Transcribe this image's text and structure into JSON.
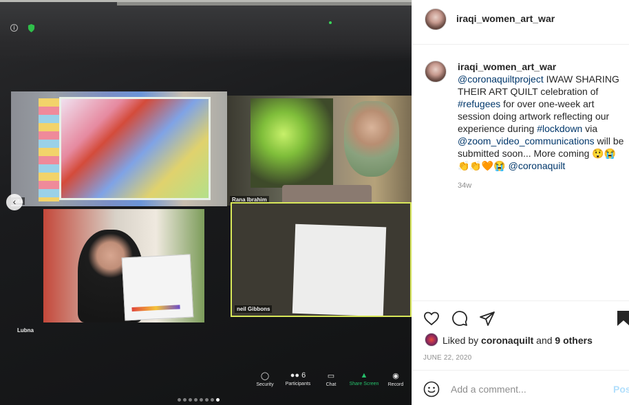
{
  "post": {
    "username": "iraqi_women_art_war",
    "caption": {
      "username": "iraqi_women_art_war",
      "mention_project": "@coronaquiltproject",
      "text1": " IWAW SHARING THEIR ART QUILT celebration of ",
      "hashtag_refugees": "#refugees",
      "text2": " for over one-week art session doing artwork reflecting our experience during ",
      "hashtag_lockdown": "#lockdown",
      "text3": " via ",
      "mention_zoom": "@zoom_video_communications",
      "text4": " will be submitted soon... More coming ",
      "emoji1": "😲😭",
      "emoji2": "👏👏🧡😭 ",
      "mention_quilt": "@coronaquilt"
    },
    "time_ago": "34w",
    "likes": {
      "prefix": "Liked by ",
      "user": "coronaquilt",
      "middle": " and ",
      "others": "9 others"
    },
    "date": "JUNE 22, 2020",
    "comment_placeholder": "Add a comment...",
    "post_label": "Post"
  },
  "zoom_tiles": {
    "tile1_label": "nita",
    "tile2_label": "Rana Ibrahim",
    "tile3_label": "Lubna",
    "tile4_label": "neil Gibbons"
  },
  "zoom_toolbar": {
    "security": "Security",
    "participants": "Participants",
    "participants_count": "6",
    "chat": "Chat",
    "share_screen": "Share Screen",
    "record": "Record"
  },
  "carousel": {
    "count": 8,
    "active_index": 7
  },
  "icons": {
    "heart": "heart-icon",
    "comment": "comment-icon",
    "share": "share-icon",
    "save": "save-icon",
    "emoji": "emoji-icon"
  },
  "colors": {
    "link": "#00376b",
    "secondary_text": "#8e8e8e",
    "post_button_disabled": "#b2dffc",
    "zoom_green": "#25c06b"
  }
}
